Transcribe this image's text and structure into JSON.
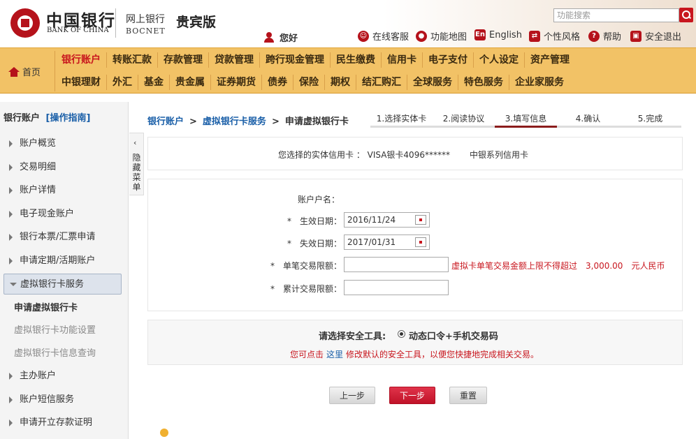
{
  "header": {
    "logo_cn": "中国银行",
    "logo_en": "BANK OF CHINA",
    "sub_cn": "网上银行",
    "sub_en": "BOCNET",
    "edition": "贵宾版",
    "search_placeholder": "功能搜索",
    "hello": "您好",
    "links": {
      "online_service": "在线客服",
      "site_map": "功能地图",
      "english": "English",
      "style": "个性风格",
      "help": "帮助",
      "logout": "安全退出"
    }
  },
  "nav": {
    "home": "首页",
    "row1": [
      "银行账户",
      "转账汇款",
      "存款管理",
      "贷款管理",
      "跨行现金管理",
      "民生缴费",
      "信用卡",
      "电子支付",
      "个人设定",
      "资产管理"
    ],
    "row2": [
      "中银理财",
      "外汇",
      "基金",
      "贵金属",
      "证券期货",
      "债券",
      "保险",
      "期权",
      "结汇购汇",
      "全球服务",
      "特色服务",
      "企业家服务"
    ]
  },
  "sidebar": {
    "title": "银行账户",
    "guide": "[操作指南]",
    "items": {
      "overview": "账户概览",
      "details": "交易明细",
      "info": "账户详情",
      "ecash": "电子现金账户",
      "draft": "银行本票/汇票申请",
      "deposit": "申请定期/活期账户",
      "virtual": "虚拟银行卡服务",
      "main": "主办账户",
      "sms": "账户短信服务",
      "cert": "申请开立存款证明"
    },
    "sub": {
      "apply": "申请虚拟银行卡",
      "settings": "虚拟银行卡功能设置",
      "query": "虚拟银行卡信息查询"
    },
    "collapse_arrow": "‹",
    "collapse_label": "隐藏菜单"
  },
  "breadcrumb": {
    "l1": "银行账户",
    "sep": ">",
    "l2": "虚拟银行卡服务",
    "l3": "申请虚拟银行卡"
  },
  "steps": [
    "1.选择实体卡",
    "2.阅读协议",
    "3.填写信息",
    "4.确认",
    "5.完成"
  ],
  "card_info": {
    "label": "您选择的实体信用卡 ： VISA银卡4096******",
    "series": "中银系列信用卡"
  },
  "form": {
    "name_label": "账户户名：",
    "start_label": "*　生效日期：",
    "start_value": "2016/11/24",
    "end_label": "*　失效日期：",
    "end_value": "2017/01/31",
    "single_label": "*　单笔交易限额：",
    "single_hint": "虚拟卡单笔交易金额上限不得超过　3,000.00　元人民币",
    "total_label": "*　累计交易限额："
  },
  "security": {
    "label": "请选择安全工具:",
    "option": "动态口令+手机交易码",
    "note_pre": "您可点击",
    "note_link": "这里",
    "note_post": "修改默认的安全工具，以便您快捷地完成相关交易。"
  },
  "buttons": {
    "prev": "上一步",
    "next": "下一步",
    "reset": "重置"
  },
  "colors": {
    "brand_red": "#c8161e",
    "nav_gold": "#f2c266",
    "link_blue": "#1a5fa8"
  }
}
